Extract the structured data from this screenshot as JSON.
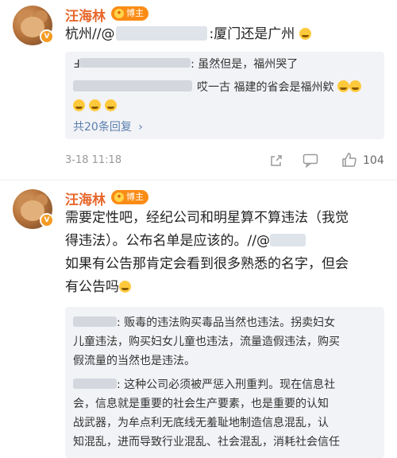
{
  "posts": [
    {
      "author": "汪海林",
      "badge": "博主",
      "text_prefix": "杭州//@",
      "text_suffix": ":厦门还是广州",
      "quotes": [
        {
          "prefix": "Ⅎ",
          "text": ": 虽然但是，福州哭了"
        },
        {
          "text": "哎一古 福建的省会是福州欸"
        }
      ],
      "reply_count": "共20条回复",
      "time": "3-18 11:18",
      "likes": "104"
    },
    {
      "author": "汪海林",
      "badge": "博主",
      "lines": [
        "需要定性吧，经纪公司和明星算不算违法（我觉",
        "得违法）。公布名单是应该的。//@",
        "如果有公告那肯定会看到很多熟悉的名字，但会",
        "有公告吗"
      ],
      "quote_lines_1": [
        ": 贩毒的违法购买毒品当然也违法。拐卖妇女",
        "儿童违法，购买妇女儿童也违法，流量造假违法，购买",
        "假流量的当然也是违法。"
      ],
      "quote_lines_2": [
        ": 这种公司必须被严惩入刑重判。现在信息社",
        "会，信息就是重要的社会生产要素，也是重要的认知",
        "战武器，为牟点利无底线无羞耻地制造信息混乱，认",
        "知混乱，进而导致行业混乱、社会混乱，消耗社会信任"
      ]
    }
  ]
}
